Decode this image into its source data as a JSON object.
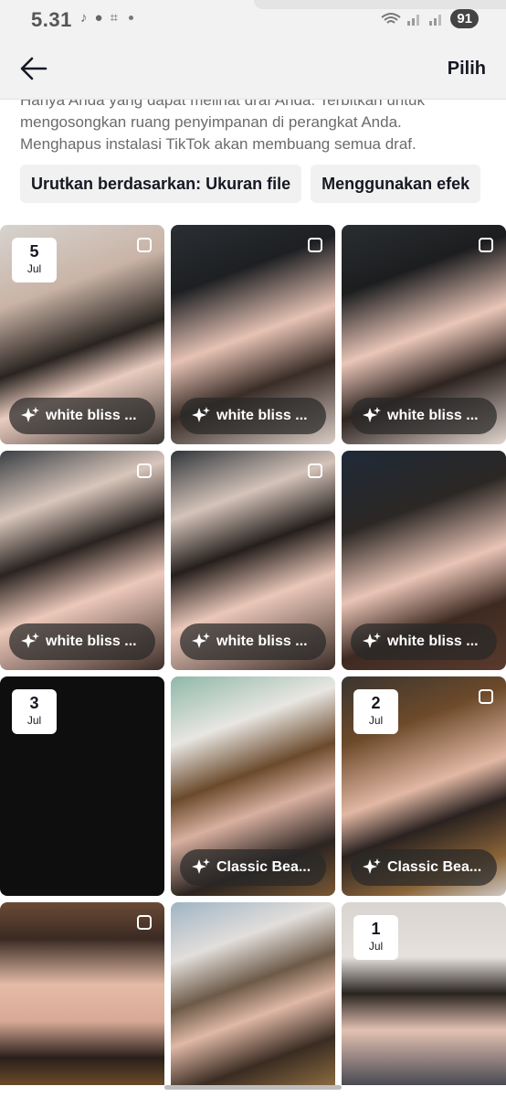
{
  "status_bar": {
    "time": "5.31",
    "battery": "91"
  },
  "header": {
    "back_icon": "arrow-left-icon",
    "action_label": "Pilih"
  },
  "notice": {
    "line1": "Hanya Anda yang dapat melihat draf Anda. Terbitkan untuk",
    "line2": "mengosongkan ruang penyimpanan di perangkat Anda.",
    "line3": "Menghapus instalasi TikTok akan membuang semua draf."
  },
  "chips": {
    "sort": "Urutkan berdasarkan: Ukuran file",
    "effect": "Menggunakan efek"
  },
  "drafts": [
    {
      "date_day": "5",
      "date_month": "Jul",
      "effect": "white bliss ..."
    },
    {
      "date_day": "",
      "date_month": "",
      "effect": "white bliss ..."
    },
    {
      "date_day": "",
      "date_month": "",
      "effect": "white bliss ..."
    },
    {
      "date_day": "",
      "date_month": "",
      "effect": "white bliss ..."
    },
    {
      "date_day": "",
      "date_month": "",
      "effect": "white bliss ..."
    },
    {
      "date_day": "",
      "date_month": "",
      "effect": "white bliss ..."
    },
    {
      "date_day": "3",
      "date_month": "Jul",
      "effect": ""
    },
    {
      "date_day": "",
      "date_month": "",
      "effect": "Classic Bea..."
    },
    {
      "date_day": "2",
      "date_month": "Jul",
      "effect": "Classic Bea..."
    },
    {
      "date_day": "",
      "date_month": "",
      "effect": ""
    },
    {
      "date_day": "",
      "date_month": "",
      "effect": ""
    },
    {
      "date_day": "1",
      "date_month": "Jul",
      "effect": ""
    }
  ],
  "colors": {
    "accent_dark": "#161823",
    "chip_bg": "#f1f1f2",
    "header_bg": "#f2f2f2"
  }
}
